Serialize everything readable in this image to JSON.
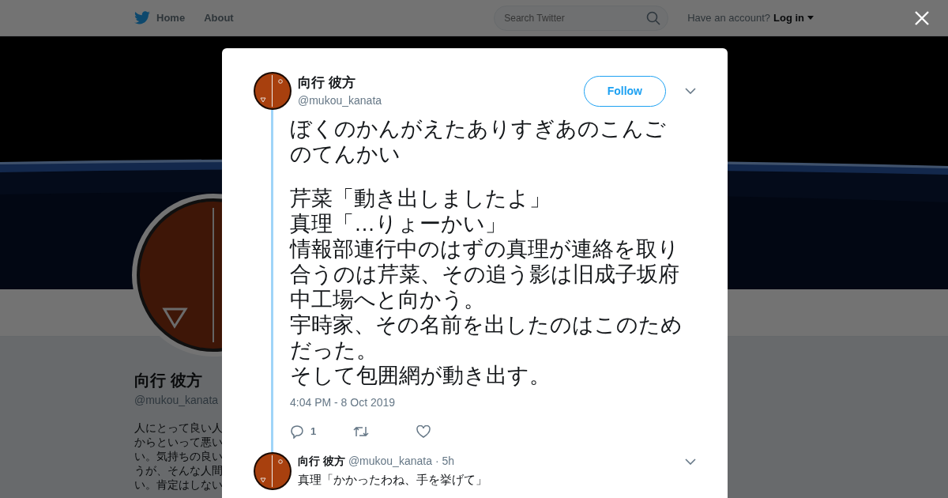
{
  "nav": {
    "items": [
      {
        "kind": "home",
        "label": "Home"
      },
      {
        "kind": "plain",
        "label": "About"
      }
    ],
    "search": {
      "placeholder": "Search Twitter"
    },
    "account_prompt": "Have an account?",
    "login": "Log in"
  },
  "profile": {
    "name": "向行 彼方",
    "handle": "@mukou_kanata",
    "bio_lines": [
      "人にとって良い人",
      "からといって悪い",
      "い。気持ちの良い",
      "うが、そんな人間",
      "い。肯定はしない"
    ]
  },
  "tweet": {
    "name": "向行 彼方",
    "handle": "@mukou_kanata",
    "follow": "Follow",
    "paragraphs": [
      [
        "ぼくのかんがえたありすぎあのこんごのてんかい"
      ],
      [
        "芹菜「動き出しましたよ」",
        "真理「…りょーかい」",
        "情報部連行中のはずの真理が連絡を取り合うのは芹菜、その追う影は旧成子坂府中工場へと向かう。",
        "宇時家、その名前を出したのはこのためだった。",
        "そして包囲網が動き出す。"
      ]
    ],
    "timestamp": "4:04 PM - 8 Oct 2019",
    "actions": [
      {
        "kind": "reply",
        "count": "1"
      },
      {
        "kind": "retweet"
      },
      {
        "kind": "like"
      }
    ]
  },
  "reply_tweet": {
    "name": "向行 彼方",
    "handle": "@mukou_kanata",
    "meta": "· 5h",
    "text": "真理「かかったわね、手を挙げて」"
  }
}
